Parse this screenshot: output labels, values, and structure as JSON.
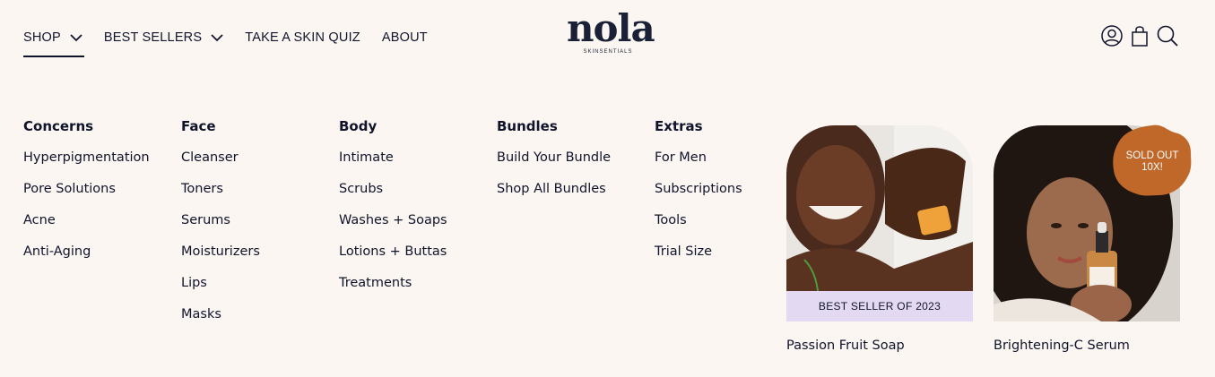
{
  "nav": {
    "shop": "SHOP",
    "best_sellers": "BEST SELLERS",
    "quiz": "TAKE A SKIN QUIZ",
    "about": "ABOUT"
  },
  "logo": {
    "word": "nola",
    "sub": "SKINSENTIALS"
  },
  "icons": [
    "account-icon",
    "bag-icon",
    "search-icon"
  ],
  "menu": {
    "concerns": {
      "title": "Concerns",
      "items": [
        "Hyperpigmentation",
        "Pore Solutions",
        "Acne",
        "Anti-Aging"
      ]
    },
    "face": {
      "title": "Face",
      "items": [
        "Cleanser",
        "Toners",
        "Serums",
        "Moisturizers",
        "Lips",
        "Masks"
      ]
    },
    "body": {
      "title": "Body",
      "items": [
        "Intimate",
        "Scrubs",
        "Washes + Soaps",
        "Lotions + Buttas",
        "Treatments"
      ]
    },
    "bundles": {
      "title": "Bundles",
      "items": [
        "Build Your Bundle",
        "Shop All Bundles"
      ]
    },
    "extras": {
      "title": "Extras",
      "items": [
        "For Men",
        "Subscriptions",
        "Tools",
        "Trial Size"
      ]
    }
  },
  "products": [
    {
      "name": "Passion Fruit Soap",
      "banner": "BEST SELLER OF 2023"
    },
    {
      "name": "Brightening-C Serum",
      "badge_line1": "SOLD OUT",
      "badge_line2": "10X!"
    }
  ],
  "colors": {
    "background": "#fbf6f2",
    "text": "#10142b",
    "banner": "#e4d9f2",
    "badge": "#c0672a"
  }
}
